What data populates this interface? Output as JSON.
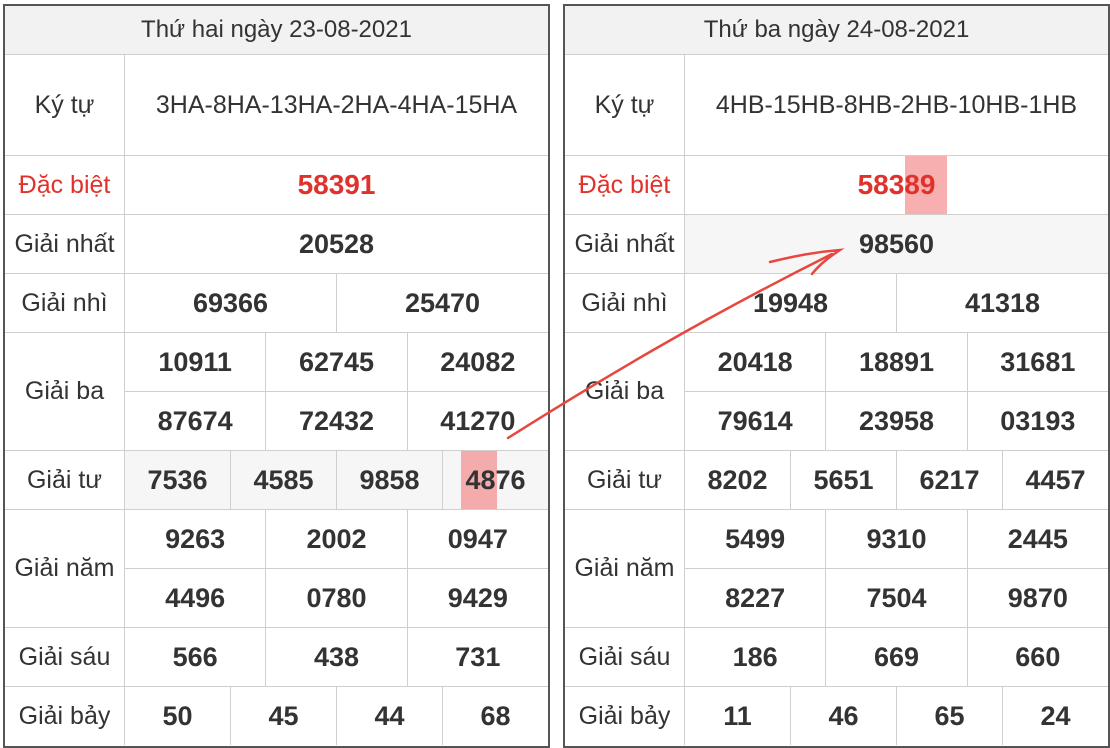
{
  "left": {
    "date_header": "Thứ hai ngày 23-08-2021",
    "ky_tu_label": "Ký tự",
    "ky_tu_value": "3HA-8HA-13HA-2HA-4HA-15HA",
    "rows": {
      "db": {
        "label": "Đặc biệt",
        "values": [
          "58391"
        ]
      },
      "g1": {
        "label": "Giải nhất",
        "values": [
          "20528"
        ]
      },
      "g2": {
        "label": "Giải nhì",
        "values": [
          "69366",
          "25470"
        ]
      },
      "g3": {
        "label": "Giải ba",
        "values": [
          "10911",
          "62745",
          "24082",
          "87674",
          "72432",
          "41270"
        ]
      },
      "g4": {
        "label": "Giải tư",
        "values": [
          "7536",
          "4585",
          "9858",
          "4876"
        ]
      },
      "g5": {
        "label": "Giải năm",
        "values": [
          "9263",
          "2002",
          "0947",
          "4496",
          "0780",
          "9429"
        ]
      },
      "g6": {
        "label": "Giải sáu",
        "values": [
          "566",
          "438",
          "731"
        ]
      },
      "g7": {
        "label": "Giải bảy",
        "values": [
          "50",
          "45",
          "44",
          "68"
        ]
      }
    }
  },
  "right": {
    "date_header": "Thứ ba ngày 24-08-2021",
    "ky_tu_label": "Ký tự",
    "ky_tu_value": "4HB-15HB-8HB-2HB-10HB-1HB",
    "rows": {
      "db": {
        "label": "Đặc biệt",
        "values": [
          "58389"
        ]
      },
      "g1": {
        "label": "Giải nhất",
        "values": [
          "98560"
        ]
      },
      "g2": {
        "label": "Giải nhì",
        "values": [
          "19948",
          "41318"
        ]
      },
      "g3": {
        "label": "Giải ba",
        "values": [
          "20418",
          "18891",
          "31681",
          "79614",
          "23958",
          "03193"
        ]
      },
      "g4": {
        "label": "Giải tư",
        "values": [
          "8202",
          "5651",
          "6217",
          "4457"
        ]
      },
      "g5": {
        "label": "Giải năm",
        "values": [
          "5499",
          "9310",
          "2445",
          "8227",
          "7504",
          "9870"
        ]
      },
      "g6": {
        "label": "Giải sáu",
        "values": [
          "186",
          "669",
          "660"
        ]
      },
      "g7": {
        "label": "Giải bảy",
        "values": [
          "11",
          "46",
          "65",
          "24"
        ]
      }
    }
  },
  "colors": {
    "special_red": "#e0322c",
    "highlight": "#f06e6e",
    "arrow": "#e8473f"
  }
}
